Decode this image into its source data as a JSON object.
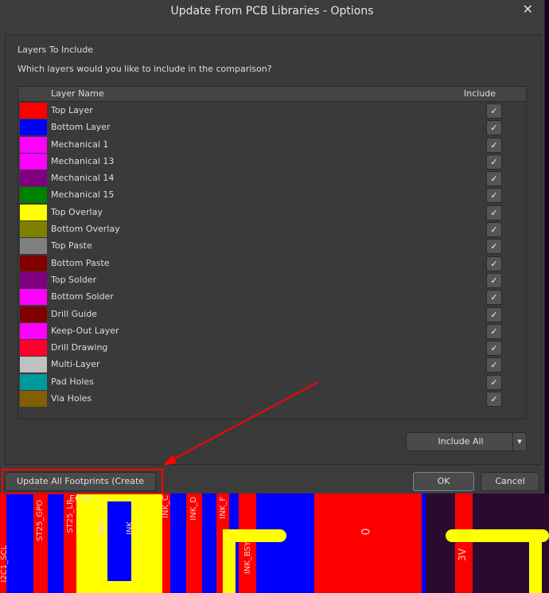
{
  "dialog": {
    "title": "Update From PCB Libraries - Options",
    "section_title": "Layers To Include",
    "question": "Which layers would you like to include in the comparison?"
  },
  "table": {
    "headers": [
      "Layer Name",
      "Include"
    ],
    "rows": [
      {
        "name": "Top Layer",
        "color": "#ff0000",
        "include": true
      },
      {
        "name": "Bottom Layer",
        "color": "#0000ff",
        "include": true
      },
      {
        "name": "Mechanical 1",
        "color": "#ff00ff",
        "include": true
      },
      {
        "name": "Mechanical 13",
        "color": "#ff00ff",
        "include": true
      },
      {
        "name": "Mechanical 14",
        "color": "#800080",
        "include": true
      },
      {
        "name": "Mechanical 15",
        "color": "#008000",
        "include": true
      },
      {
        "name": "Top Overlay",
        "color": "#ffff00",
        "include": true
      },
      {
        "name": "Bottom Overlay",
        "color": "#808000",
        "include": true
      },
      {
        "name": "Top Paste",
        "color": "#808080",
        "include": true
      },
      {
        "name": "Bottom Paste",
        "color": "#800000",
        "include": true
      },
      {
        "name": "Top Solder",
        "color": "#800080",
        "include": true
      },
      {
        "name": "Bottom Solder",
        "color": "#ff00ff",
        "include": true
      },
      {
        "name": "Drill Guide",
        "color": "#800000",
        "include": true
      },
      {
        "name": "Keep-Out Layer",
        "color": "#ff00ff",
        "include": true
      },
      {
        "name": "Drill Drawing",
        "color": "#ff002a",
        "include": true
      },
      {
        "name": "Multi-Layer",
        "color": "#c0c0c0",
        "include": true
      },
      {
        "name": "Pad Holes",
        "color": "#009999",
        "include": true
      },
      {
        "name": "Via Holes",
        "color": "#806000",
        "include": true
      }
    ]
  },
  "buttons": {
    "include_all": "Include All",
    "update_all": "Update All Footprints (Create ECO)",
    "ok": "OK",
    "cancel": "Cancel"
  },
  "pcb_labels": [
    "I2C1_SCL",
    "ST25_GPO",
    "ST25_LP",
    "INK_",
    "INK_",
    "INK_C",
    "INK_D",
    "INK_F",
    "INK_BSY",
    "0",
    "3V"
  ],
  "annotation_color": "#ff0000"
}
